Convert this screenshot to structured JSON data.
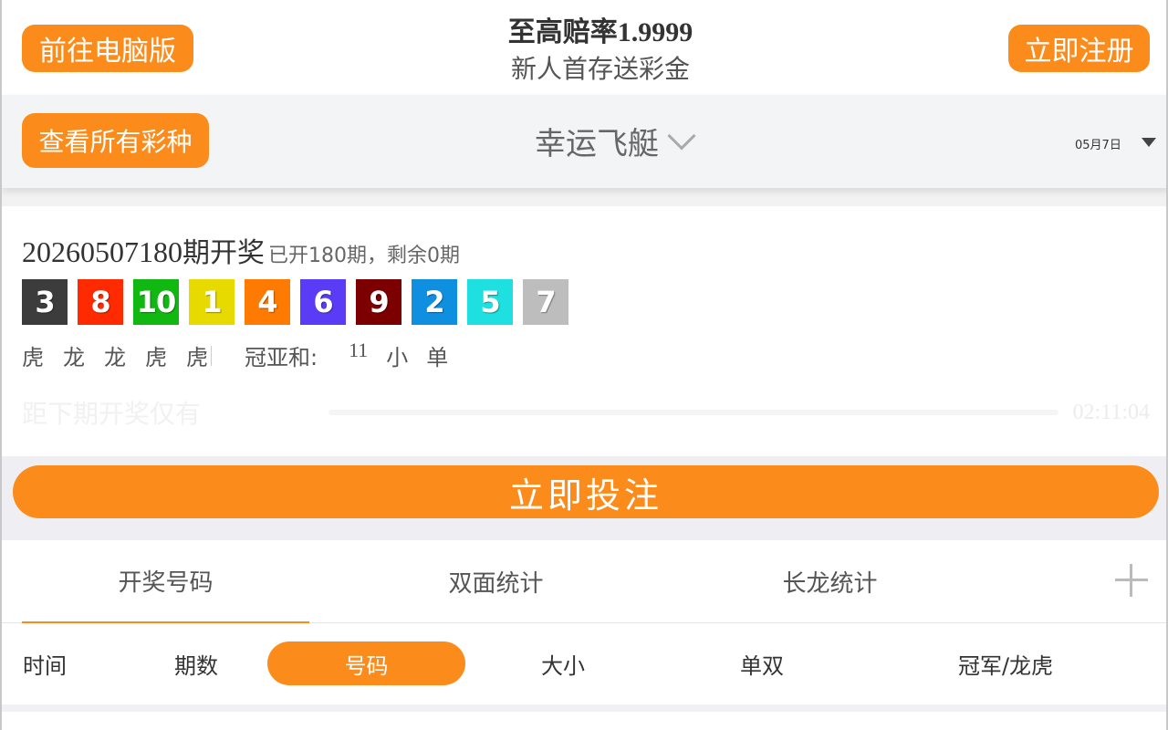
{
  "header": {
    "pc_button": "前往电脑版",
    "register_button": "立即注册",
    "promo_title_prefix": "至高赔率",
    "promo_title_odds": "1.9999",
    "promo_subtitle": "新人首存送彩金"
  },
  "subheader": {
    "all_lotteries_button": "查看所有彩种",
    "lottery_name": "幸运飞艇",
    "date": "05月7日"
  },
  "result": {
    "issue_number": "20260507180",
    "issue_label": "期开奖",
    "issue_sub": "已开180期，剩余0期",
    "balls": [
      {
        "value": "3",
        "color": "#3c3c3c"
      },
      {
        "value": "8",
        "color": "#ff2a00"
      },
      {
        "value": "10",
        "color": "#12b812"
      },
      {
        "value": "1",
        "color": "#e6da00"
      },
      {
        "value": "4",
        "color": "#ff7a00"
      },
      {
        "value": "6",
        "color": "#5b3cf6"
      },
      {
        "value": "9",
        "color": "#7d0000"
      },
      {
        "value": "2",
        "color": "#0f8fe0"
      },
      {
        "value": "5",
        "color": "#1fe0e0"
      },
      {
        "value": "7",
        "color": "#bdbdbd"
      }
    ],
    "dragon_tiger": [
      "虎",
      "龙",
      "龙",
      "虎",
      "虎"
    ],
    "guanya_label": "冠亚和:",
    "guanya_sum": "11",
    "guanya_bigsmall": "小",
    "guanya_oddeven": "单",
    "countdown_label": "距下期开奖仅有",
    "countdown_time": "02:11:04"
  },
  "bet_button": "立即投注",
  "tabs": [
    "开奖号码",
    "双面统计",
    "长龙统计"
  ],
  "filters": [
    "时间",
    "期数",
    "号码",
    "大小",
    "单双",
    "冠军/龙虎"
  ],
  "colors": {
    "accent": "#fb8c1c"
  }
}
